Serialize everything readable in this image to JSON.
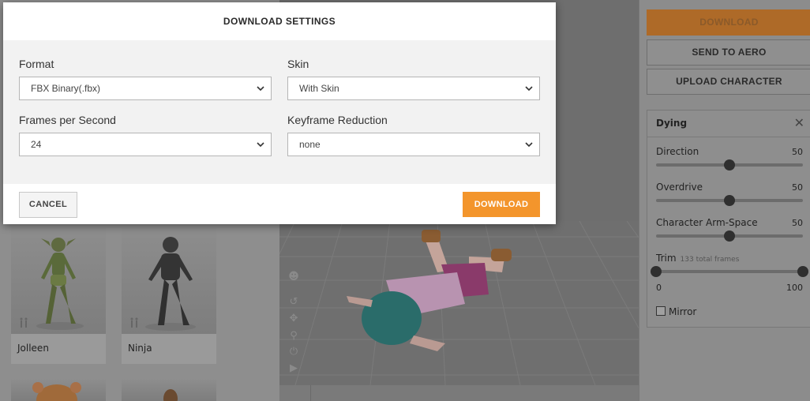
{
  "modal": {
    "title": "DOWNLOAD SETTINGS",
    "fields": {
      "format": {
        "label": "Format",
        "value": "FBX Binary(.fbx)"
      },
      "skin": {
        "label": "Skin",
        "value": "With Skin"
      },
      "fps": {
        "label": "Frames per Second",
        "value": "24"
      },
      "keyframe": {
        "label": "Keyframe Reduction",
        "value": "none"
      }
    },
    "cancel_label": "CANCEL",
    "download_label": "DOWNLOAD"
  },
  "library": {
    "characters": [
      {
        "name": "Jolleen"
      },
      {
        "name": "Ninja"
      }
    ]
  },
  "panel": {
    "download_label": "DOWNLOAD",
    "send_label": "SEND TO AERO",
    "upload_label": "UPLOAD CHARACTER",
    "animation": {
      "title": "Dying",
      "direction": {
        "label": "Direction",
        "value": "50"
      },
      "overdrive": {
        "label": "Overdrive",
        "value": "50"
      },
      "arm_space": {
        "label": "Character Arm-Space",
        "value": "50"
      },
      "trim": {
        "label": "Trim",
        "sub": "133 total frames",
        "min": "0",
        "max": "100"
      },
      "mirror_label": "Mirror"
    }
  },
  "colors": {
    "accent": "#f3952c",
    "overlay_accent": "#ae6a28"
  },
  "icons": [
    "chevron-down-icon",
    "close-icon",
    "rig-icon",
    "undo-icon",
    "move-icon",
    "zoom-icon",
    "power-icon",
    "camera-icon",
    "face-icon"
  ]
}
